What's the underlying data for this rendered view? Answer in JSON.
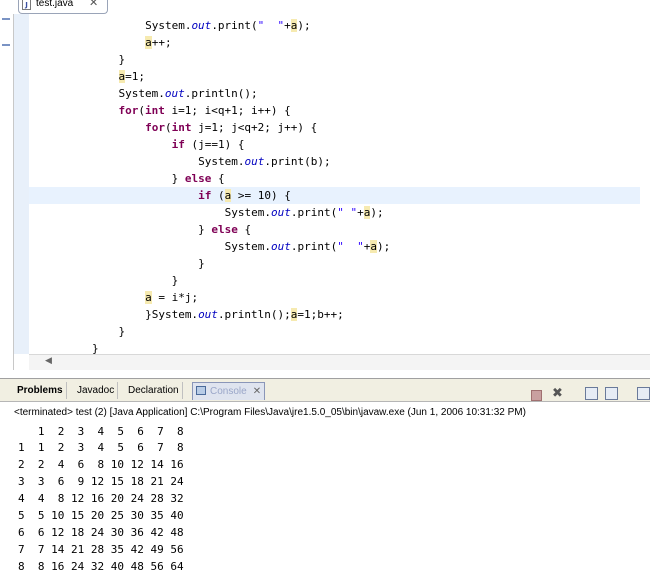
{
  "editor": {
    "tab_label": "test.java",
    "tab_close": "✕",
    "lines": [
      {
        "indent": 16,
        "segments": [
          {
            "t": "System."
          },
          {
            "t": "out",
            "c": "fd"
          },
          {
            "t": ".print("
          },
          {
            "t": "\"  \"",
            "c": "st"
          },
          {
            "t": "+"
          },
          {
            "t": "a",
            "c": "mk"
          },
          {
            "t": ");"
          }
        ]
      },
      {
        "indent": 16,
        "segments": [
          {
            "t": "a",
            "c": "mk"
          },
          {
            "t": "++;"
          }
        ]
      },
      {
        "indent": 12,
        "segments": [
          {
            "t": "}"
          }
        ]
      },
      {
        "indent": 12,
        "segments": [
          {
            "t": "a",
            "c": "mk"
          },
          {
            "t": "=1;"
          }
        ]
      },
      {
        "indent": 12,
        "segments": [
          {
            "t": "System."
          },
          {
            "t": "out",
            "c": "fd"
          },
          {
            "t": ".println();"
          }
        ]
      },
      {
        "indent": 12,
        "segments": [
          {
            "t": "for",
            "c": "kw"
          },
          {
            "t": "("
          },
          {
            "t": "int",
            "c": "kw"
          },
          {
            "t": " i=1; i<q+1; i++) {"
          }
        ]
      },
      {
        "indent": 16,
        "segments": [
          {
            "t": "for",
            "c": "kw"
          },
          {
            "t": "("
          },
          {
            "t": "int",
            "c": "kw"
          },
          {
            "t": " j=1; j<q+2; j++) {"
          }
        ]
      },
      {
        "indent": 20,
        "segments": [
          {
            "t": "if",
            "c": "kw"
          },
          {
            "t": " (j==1) {"
          }
        ]
      },
      {
        "indent": 24,
        "segments": [
          {
            "t": "System."
          },
          {
            "t": "out",
            "c": "fd"
          },
          {
            "t": ".print(b);"
          }
        ]
      },
      {
        "indent": 20,
        "segments": [
          {
            "t": "} "
          },
          {
            "t": "else",
            "c": "kw"
          },
          {
            "t": " {"
          }
        ]
      },
      {
        "indent": 24,
        "hl": true,
        "segments": [
          {
            "t": "if",
            "c": "kw"
          },
          {
            "t": " ("
          },
          {
            "t": "a",
            "c": "mk"
          },
          {
            "t": " >= 10) {"
          }
        ]
      },
      {
        "indent": 28,
        "segments": [
          {
            "t": "System."
          },
          {
            "t": "out",
            "c": "fd"
          },
          {
            "t": ".print("
          },
          {
            "t": "\" \"",
            "c": "st"
          },
          {
            "t": "+"
          },
          {
            "t": "a",
            "c": "mk"
          },
          {
            "t": ");"
          }
        ]
      },
      {
        "indent": 24,
        "segments": [
          {
            "t": "} "
          },
          {
            "t": "else",
            "c": "kw"
          },
          {
            "t": " {"
          }
        ]
      },
      {
        "indent": 28,
        "segments": [
          {
            "t": "System."
          },
          {
            "t": "out",
            "c": "fd"
          },
          {
            "t": ".print("
          },
          {
            "t": "\"  \"",
            "c": "st"
          },
          {
            "t": "+"
          },
          {
            "t": "a",
            "c": "mk"
          },
          {
            "t": ");"
          }
        ]
      },
      {
        "indent": 24,
        "segments": [
          {
            "t": "}"
          }
        ]
      },
      {
        "indent": 20,
        "segments": [
          {
            "t": "}"
          }
        ]
      },
      {
        "indent": 16,
        "segments": [
          {
            "t": "a",
            "c": "mk"
          },
          {
            "t": " = i*j;"
          }
        ]
      },
      {
        "indent": 16,
        "segments": [
          {
            "t": "}System."
          },
          {
            "t": "out",
            "c": "fd"
          },
          {
            "t": ".println();"
          },
          {
            "t": "a",
            "c": "mk"
          },
          {
            "t": "=1;b++;"
          }
        ]
      },
      {
        "indent": 12,
        "segments": [
          {
            "t": "}"
          }
        ]
      },
      {
        "indent": 8,
        "segments": [
          {
            "t": "}"
          }
        ]
      }
    ]
  },
  "console_view": {
    "tabs": [
      {
        "label": "Problems",
        "bold": true
      },
      {
        "label": "Javadoc",
        "bold": false
      },
      {
        "label": "Declaration",
        "bold": false
      },
      {
        "label": "Console",
        "bold": false,
        "active": true,
        "close": "✕"
      }
    ],
    "status": "<terminated> test (2) [Java Application] C:\\Program Files\\Java\\jre1.5.0_05\\bin\\javaw.exe (Jun 1, 2006 10:31:32 PM)",
    "output": [
      "   1  2  3  4  5  6  7  8",
      "1  1  2  3  4  5  6  7  8",
      "2  2  4  6  8 10 12 14 16",
      "3  3  6  9 12 15 18 21 24",
      "4  4  8 12 16 20 24 28 32",
      "5  5 10 15 20 25 30 35 40",
      "6  6 12 18 24 30 36 42 48",
      "7  7 14 21 28 35 42 49 56",
      "8  8 16 24 32 40 48 56 64"
    ]
  },
  "toolbar": [
    "terminate-icon",
    "remove-launches-icon",
    "clear-console-icon",
    "scroll-lock-icon",
    "pin-console-icon",
    "open-console-icon"
  ]
}
